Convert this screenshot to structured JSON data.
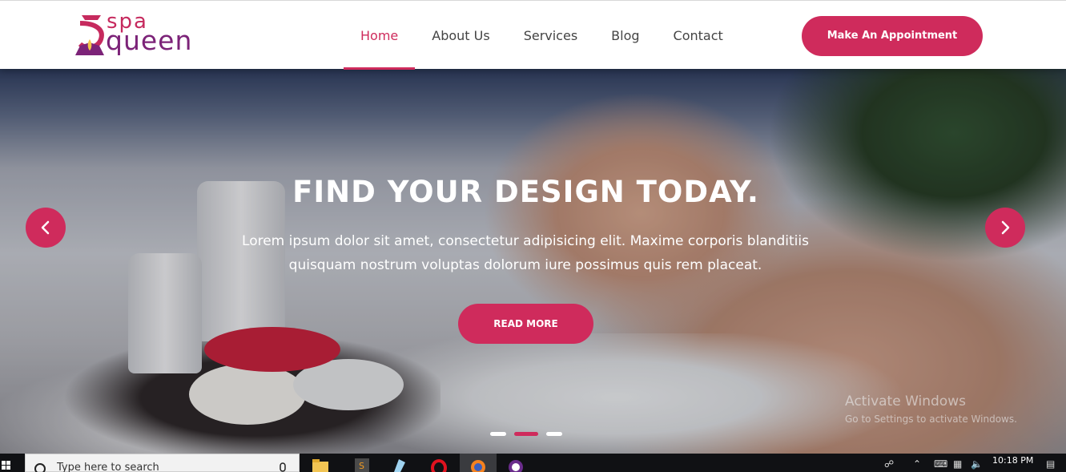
{
  "brand": {
    "logo_top": "spa",
    "logo_bottom": "queen",
    "color_primary": "#cf2b5c",
    "color_secondary": "#7c2378"
  },
  "nav": {
    "items": [
      {
        "label": "Home",
        "active": true
      },
      {
        "label": "About Us",
        "active": false
      },
      {
        "label": "Services",
        "active": false
      },
      {
        "label": "Blog",
        "active": false
      },
      {
        "label": "Contact",
        "active": false
      }
    ],
    "cta_label": "Make An Appointment"
  },
  "hero": {
    "title": "FIND YOUR DESIGN TODAY.",
    "text_line1": "Lorem ipsum dolor sit amet, consectetur adipisicing elit. Maxime corporis blanditiis",
    "text_line2": "quisquam nostrum voluptas dolorum iure possimus quis rem placeat.",
    "button_label": "READ MORE",
    "prev_icon": "chevron-left-icon",
    "next_icon": "chevron-right-icon",
    "slides_count": 3,
    "active_slide": 2
  },
  "watermark": {
    "title": "Activate Windows",
    "subtitle": "Go to Settings to activate Windows."
  },
  "taskbar": {
    "search_placeholder": "Type here to search",
    "apps": [
      "file-explorer-icon",
      "sublime-text-icon",
      "notepad-icon",
      "opera-icon",
      "firefox-icon",
      "app-icon"
    ],
    "clock": "10:18 PM"
  }
}
